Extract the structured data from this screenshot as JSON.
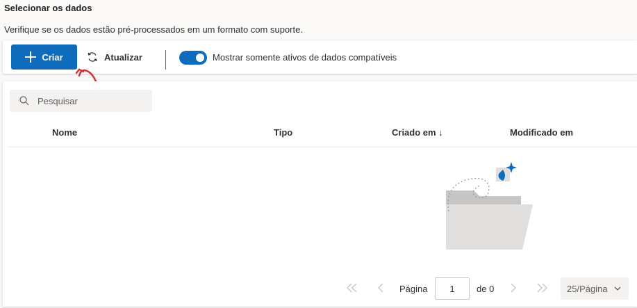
{
  "header": {
    "title": "Selecionar os dados",
    "subtitle": "Verifique se os dados estão pré-processados em um formato com suporte."
  },
  "toolbar": {
    "create_label": "Criar",
    "refresh_label": "Atualizar",
    "toggle_label": "Mostrar somente ativos de dados compatíveis",
    "toggle_on": true
  },
  "search": {
    "placeholder": "Pesquisar",
    "icon": "search-icon"
  },
  "table": {
    "columns": [
      "Nome",
      "Tipo",
      "Criado em ↓",
      "Modificado em"
    ],
    "rows": []
  },
  "pagination": {
    "page_label": "Página",
    "current_page": "1",
    "of_label": "de 0",
    "page_size": "25/Página"
  },
  "colors": {
    "accent": "#0f6cbd",
    "annotation": "#d13438"
  }
}
